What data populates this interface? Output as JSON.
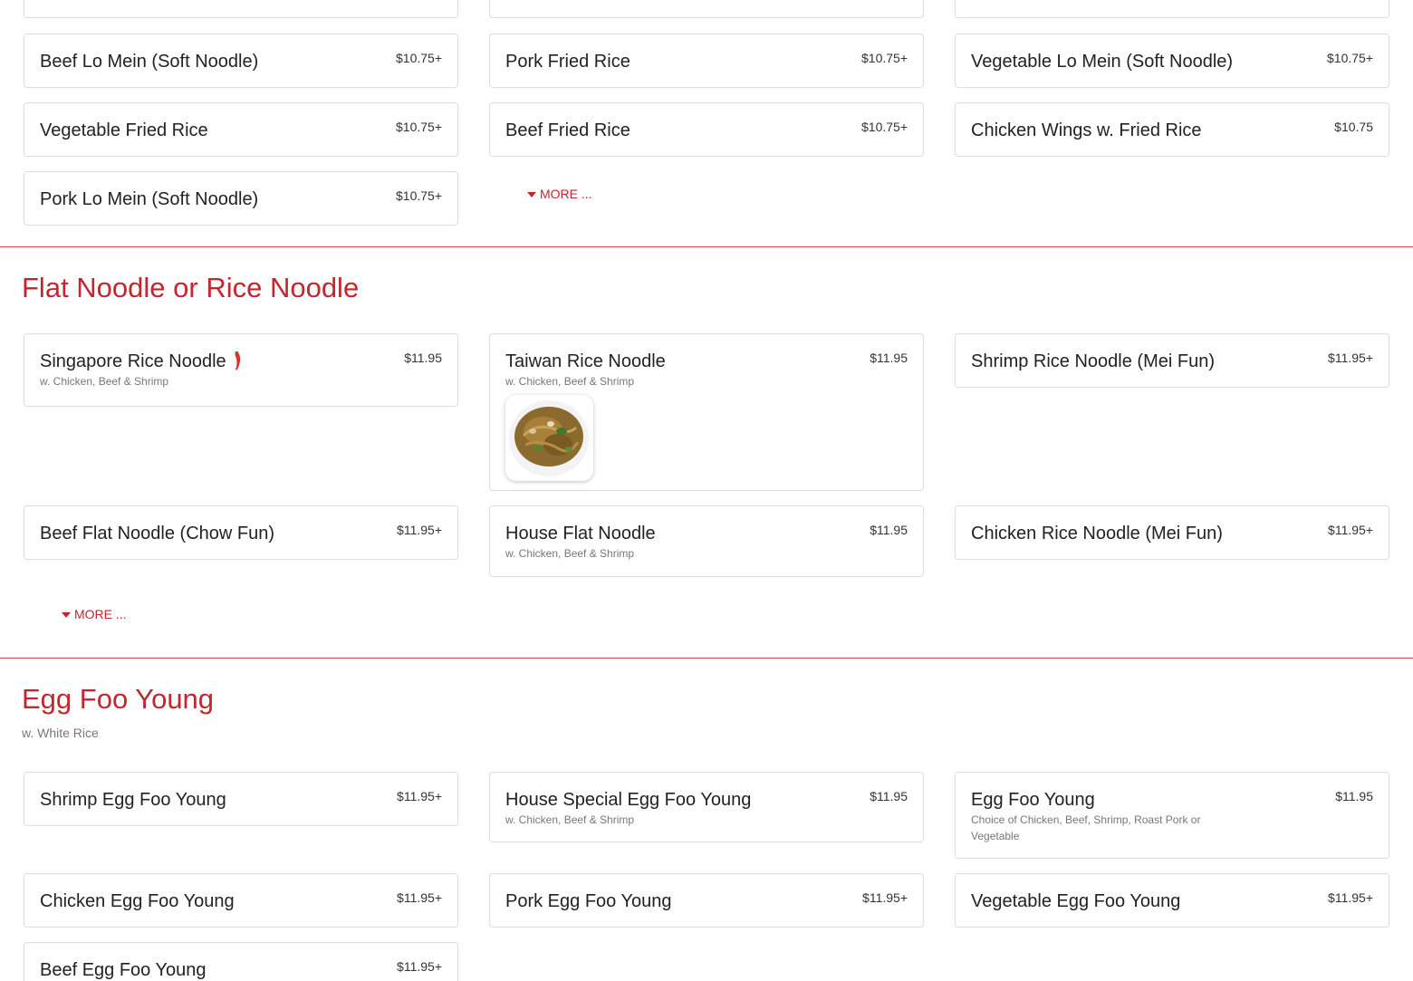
{
  "section1": {
    "items": [
      {
        "name": "Beef Lo Mein (Soft Noodle)",
        "price": "$10.75+"
      },
      {
        "name": "Pork Fried Rice",
        "price": "$10.75+"
      },
      {
        "name": "Vegetable Lo Mein (Soft Noodle)",
        "price": "$10.75+"
      },
      {
        "name": "Vegetable Fried Rice",
        "price": "$10.75+"
      },
      {
        "name": "Beef Fried Rice",
        "price": "$10.75+"
      },
      {
        "name": "Chicken Wings w. Fried Rice",
        "price": "$10.75"
      },
      {
        "name": "Pork Lo Mein (Soft Noodle)",
        "price": "$10.75+"
      }
    ],
    "more_label": "MORE ..."
  },
  "section2": {
    "title": "Flat Noodle or Rice Noodle",
    "items": [
      {
        "name": "Singapore Rice Noodle",
        "price": "$11.95",
        "desc": "w. Chicken, Beef & Shrimp",
        "icon": "chili-pepper-icon"
      },
      {
        "name": "Taiwan Rice Noodle",
        "price": "$11.95",
        "desc": "w. Chicken, Beef & Shrimp"
      },
      {
        "name": "Shrimp Rice Noodle (Mei Fun)",
        "price": "$11.95+"
      },
      {
        "name": "Beef Flat Noodle (Chow Fun)",
        "price": "$11.95+"
      },
      {
        "name": "House Flat Noodle",
        "price": "$11.95",
        "desc": "w. Chicken, Beef & Shrimp"
      },
      {
        "name": "Chicken Rice Noodle (Mei Fun)",
        "price": "$11.95+"
      }
    ],
    "more_label": "MORE ..."
  },
  "section3": {
    "title": "Egg Foo Young",
    "subtitle": "w. White Rice",
    "items": [
      {
        "name": "Shrimp Egg Foo Young",
        "price": "$11.95+"
      },
      {
        "name": "House Special Egg Foo Young",
        "price": "$11.95",
        "desc": "w. Chicken, Beef & Shrimp"
      },
      {
        "name": "Egg Foo Young",
        "price": "$11.95",
        "desc": "Choice of Chicken, Beef, Shrimp, Roast Pork or Vegetable"
      },
      {
        "name": "Chicken Egg Foo Young",
        "price": "$11.95+"
      },
      {
        "name": "Pork Egg Foo Young",
        "price": "$11.95+"
      },
      {
        "name": "Vegetable Egg Foo Young",
        "price": "$11.95+"
      },
      {
        "name": "Beef Egg Foo Young",
        "price": "$11.95+"
      }
    ]
  },
  "colors": {
    "accent": "#c1272d",
    "border": "#dddddd",
    "muted": "#777777",
    "text": "#222222"
  }
}
